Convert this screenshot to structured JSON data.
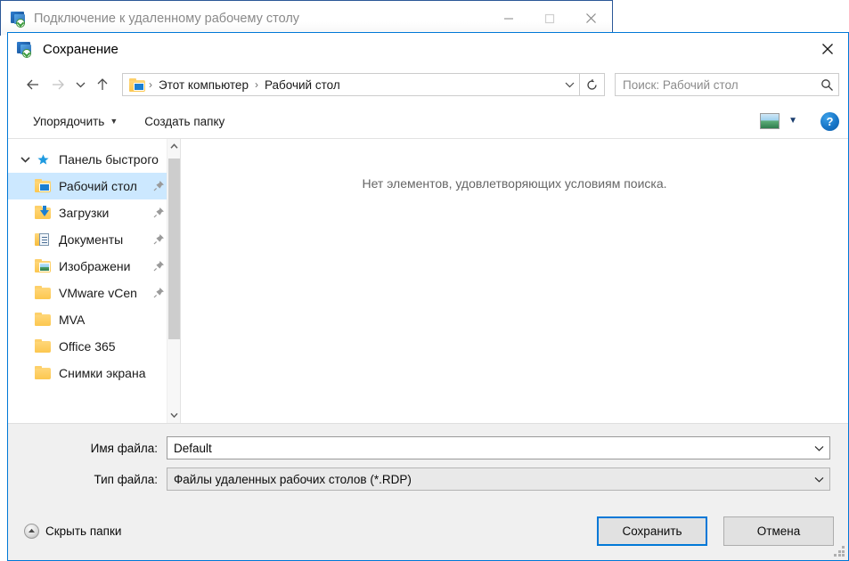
{
  "background_window": {
    "title": "Подключение к удаленному рабочему столу",
    "icon": "remote-desktop-icon",
    "caption_buttons": [
      {
        "name": "minimize",
        "glyph": "minimize-icon"
      },
      {
        "name": "maximize",
        "glyph": "maximize-icon"
      },
      {
        "name": "close",
        "glyph": "close-icon"
      }
    ]
  },
  "dialog": {
    "title": "Сохранение",
    "icon": "remote-desktop-icon",
    "close_label": "close-icon"
  },
  "navigation": {
    "back": "back-arrow-icon",
    "forward": "forward-arrow-icon",
    "recent": "chevron-down-icon",
    "up": "up-arrow-icon",
    "address": {
      "folder_icon": "desktop-folder-icon",
      "crumbs": [
        "Этот компьютер",
        "Рабочий стол"
      ],
      "separator": "›",
      "dropdown": "chevron-down-icon"
    },
    "refresh": "refresh-icon"
  },
  "search": {
    "placeholder": "Поиск: Рабочий стол",
    "value": "",
    "icon": "search-icon"
  },
  "command_bar": {
    "organize": "Упорядочить",
    "new_folder": "Создать папку",
    "view_icon": "view-layout-icon",
    "view_caret": "chevron-down-icon",
    "help": "?"
  },
  "nav_pane": {
    "root": {
      "label": "Панель быстрого",
      "icon": "star-icon",
      "expander": "chevron-down-icon",
      "expanded": true
    },
    "items": [
      {
        "label": "Рабочий стол",
        "icon": "folder-desktop-icon",
        "pinned": true,
        "selected": true
      },
      {
        "label": "Загрузки",
        "icon": "folder-downloads-icon",
        "pinned": true,
        "selected": false
      },
      {
        "label": "Документы",
        "icon": "folder-documents-icon",
        "pinned": true,
        "selected": false
      },
      {
        "label": "Изображени",
        "icon": "folder-pictures-icon",
        "pinned": true,
        "selected": false
      },
      {
        "label": "VMware vCen",
        "icon": "folder-icon",
        "pinned": true,
        "selected": false
      },
      {
        "label": "MVA",
        "icon": "folder-icon",
        "pinned": false,
        "selected": false
      },
      {
        "label": "Office 365",
        "icon": "folder-icon",
        "pinned": false,
        "selected": false
      },
      {
        "label": "Снимки экрана",
        "icon": "folder-icon",
        "pinned": false,
        "selected": false
      }
    ],
    "scrollbar": {
      "up_arrow": "chevron-up-icon",
      "down_arrow": "chevron-down-icon"
    }
  },
  "content": {
    "empty_message": "Нет элементов, удовлетворяющих условиям поиска."
  },
  "fields": {
    "filename": {
      "label": "Имя файла:",
      "value": "Default",
      "caret": "chevron-down-icon"
    },
    "filetype": {
      "label": "Тип файла:",
      "value": "Файлы удаленных рабочих столов (*.RDP)",
      "caret": "chevron-down-icon"
    }
  },
  "footer": {
    "hide_folders": "Скрыть папки",
    "hide_folders_icon": "collapse-up-icon",
    "save": "Сохранить",
    "cancel": "Отмена"
  },
  "colors": {
    "accent": "#0078d7",
    "selection": "#cce8ff",
    "dialog_chrome": "#f0f0f0"
  }
}
